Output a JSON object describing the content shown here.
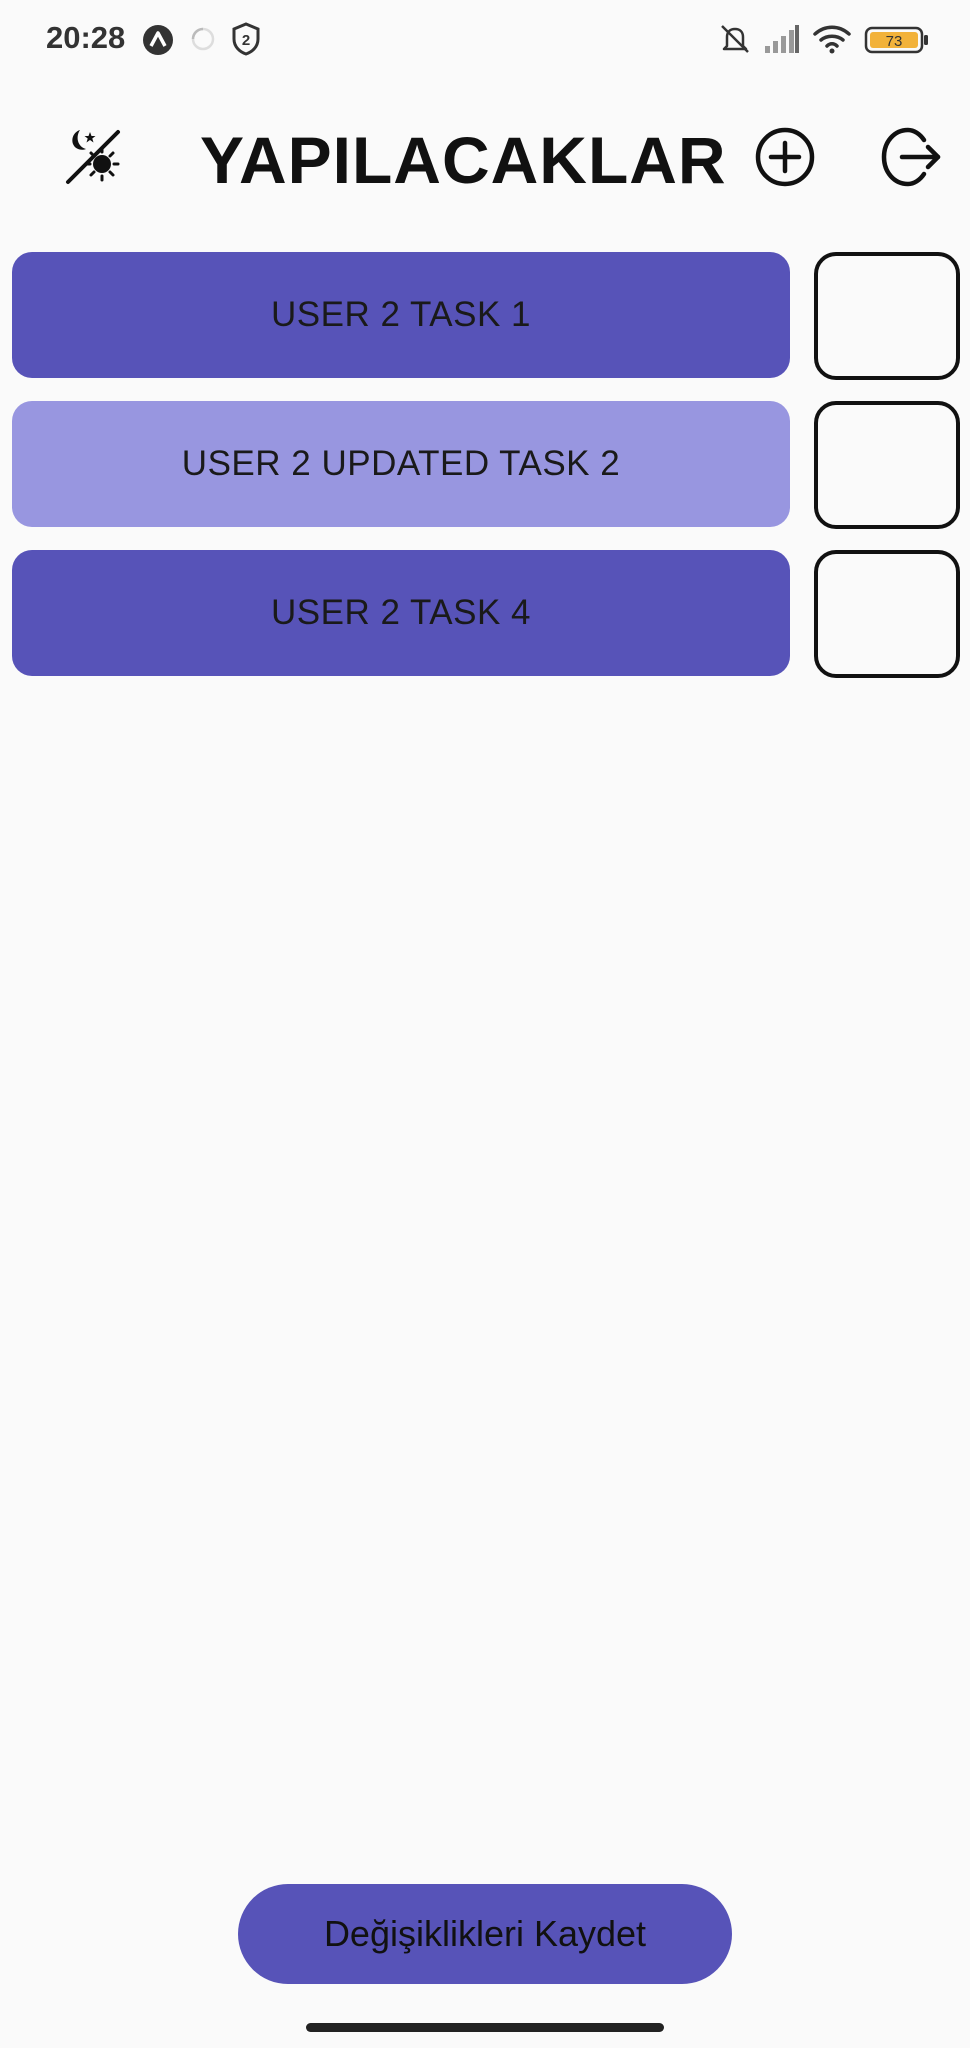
{
  "status_bar": {
    "time": "20:28",
    "battery_level": "73",
    "icons": [
      "a-badge-icon",
      "loading-circle-icon",
      "shield-2-icon",
      "silent-icon",
      "signal-icon",
      "wifi-icon",
      "battery-icon"
    ],
    "shield_count": "2"
  },
  "header": {
    "title": "YAPILACAKLAR",
    "theme_toggle_icon": "theme-toggle-icon",
    "add_icon": "add-circle-icon",
    "logout_icon": "logout-icon"
  },
  "tasks": [
    {
      "label": "USER 2 TASK 1",
      "color": "#5753b8",
      "checked": false
    },
    {
      "label": "USER 2 UPDATED TASK 2",
      "color": "#9896e0",
      "checked": false
    },
    {
      "label": "USER 2 TASK 4",
      "color": "#5753b8",
      "checked": false
    }
  ],
  "save_button": {
    "label": "Değişiklikleri Kaydet",
    "color": "#5753b8"
  },
  "colors": {
    "background": "#fafafa",
    "accent": "#5753b8",
    "accent_light": "#9896e0",
    "battery_fill": "#f2b23a"
  }
}
